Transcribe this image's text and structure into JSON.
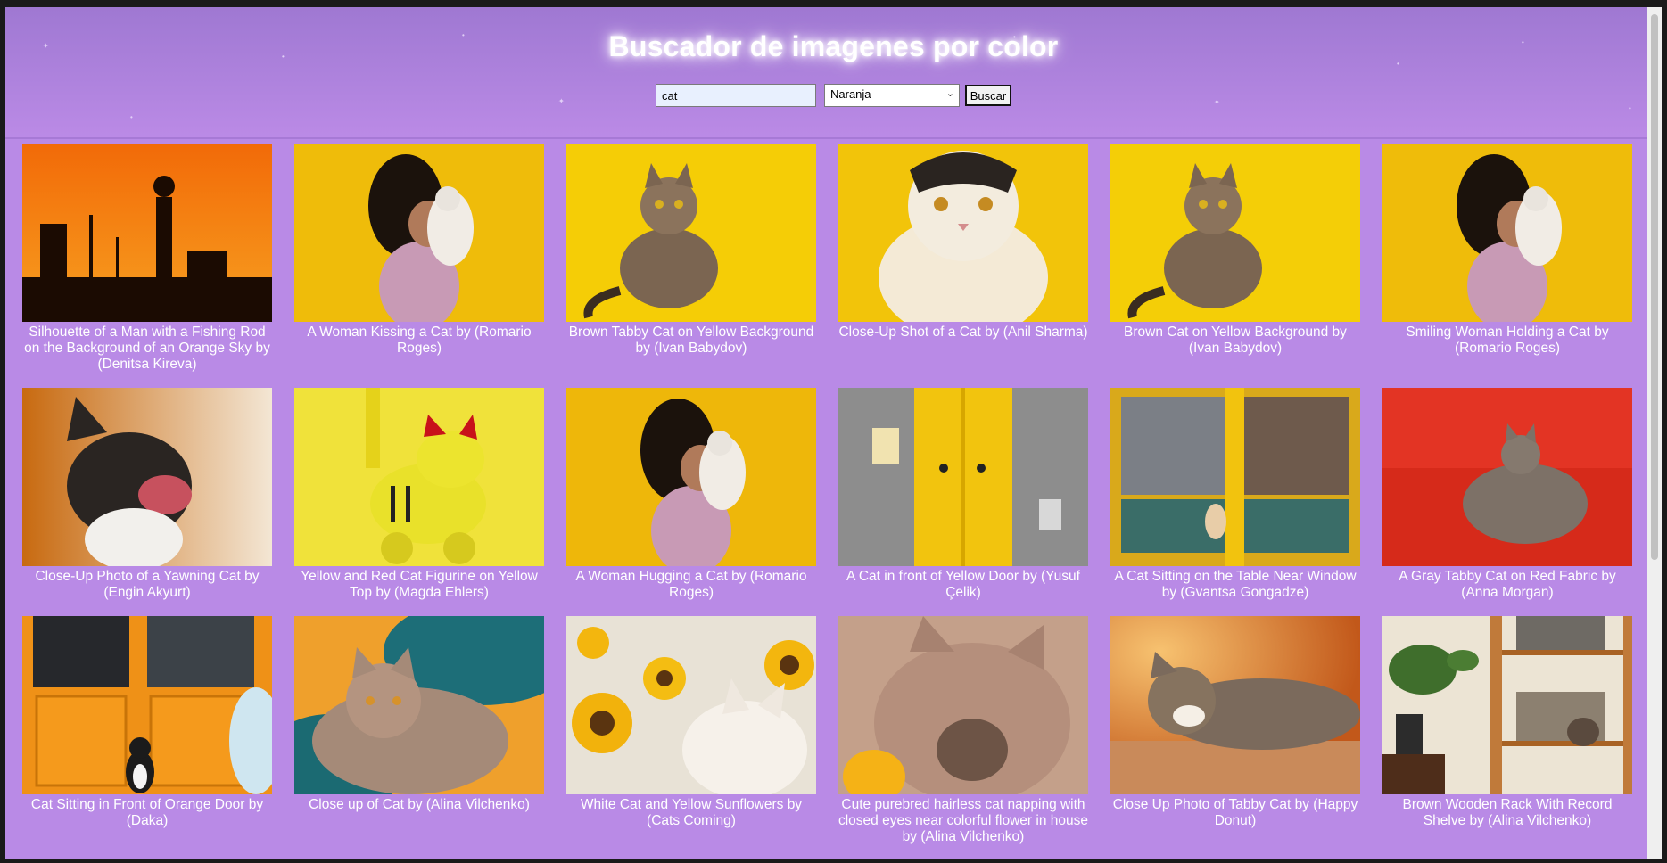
{
  "page": {
    "title": "Buscador de imagenes por color"
  },
  "search": {
    "value": "cat",
    "color_selected": "Naranja",
    "button_label": "Buscar"
  },
  "results": [
    {
      "caption": "Silhouette of a Man with a Fishing Rod on the Background of an Orange Sky by (Denitsa Kireva)",
      "bg": "#f07b12",
      "scene": "silhouette"
    },
    {
      "caption": "A Woman Kissing a Cat by (Romario Roges)",
      "bg": "#f3c10b",
      "scene": "woman"
    },
    {
      "caption": "Brown Tabby Cat on Yellow Background by (Ivan Babydov)",
      "bg": "#f5cd06",
      "scene": "tabby"
    },
    {
      "caption": "Close-Up Shot of a Cat by (Anil Sharma)",
      "bg": "#f2c40a",
      "scene": "fluffy"
    },
    {
      "caption": "Brown Cat on Yellow Background by (Ivan Babydov)",
      "bg": "#f4ce07",
      "scene": "tabby2"
    },
    {
      "caption": "Smiling Woman Holding a Cat by (Romario Roges)",
      "bg": "#f3c10b",
      "scene": "woman2"
    },
    {
      "caption": "Close-Up Photo of a Yawning Cat by (Engin Akyurt)",
      "bg": "#e08a22",
      "scene": "yawn"
    },
    {
      "caption": "Yellow and Red Cat Figurine on Yellow Top by (Magda Ehlers)",
      "bg": "#f0e23a",
      "scene": "figurine"
    },
    {
      "caption": "A Woman Hugging a Cat by (Romario Roges)",
      "bg": "#f1b90b",
      "scene": "woman3"
    },
    {
      "caption": "A Cat in front of Yellow Door by (Yusuf Çelik)",
      "bg": "#8f8f8f",
      "scene": "door"
    },
    {
      "caption": "A Cat Sitting on the Table Near Window by (Gvantsa Gongadze)",
      "bg": "#e9b51a",
      "scene": "window"
    },
    {
      "caption": "A Gray Tabby Cat on Red Fabric by (Anna Morgan)",
      "bg": "#e63322",
      "scene": "redfabric"
    },
    {
      "caption": "Cat Sitting in Front of Orange Door by (Daka)",
      "bg": "#f09418",
      "scene": "orangedoor"
    },
    {
      "caption": "Close up of Cat by (Alina Vilchenko)",
      "bg": "#e9a22a",
      "scene": "blanket"
    },
    {
      "caption": "White Cat and Yellow Sunflowers by (Cats Coming)",
      "bg": "#e9e1d5",
      "scene": "sunflowers"
    },
    {
      "caption": "Cute purebred hairless cat napping with closed eyes near colorful flower in house by (Alina Vilchenko)",
      "bg": "#c9a58e",
      "scene": "hairless"
    },
    {
      "caption": "Close Up Photo of Tabby Cat by (Happy Donut)",
      "bg": "#e07b2a",
      "scene": "sleepy"
    },
    {
      "caption": "Brown Wooden Rack With Record Shelve by (Alina Vilchenko)",
      "bg": "#e9e0cf",
      "scene": "shelf"
    }
  ]
}
